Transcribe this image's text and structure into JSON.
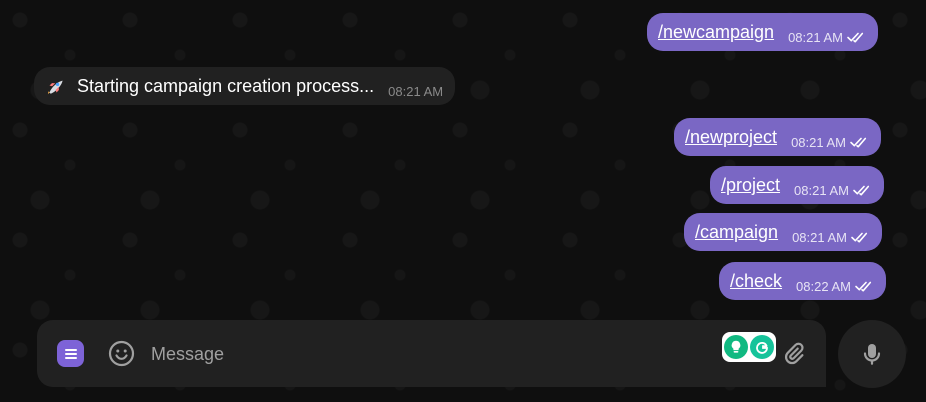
{
  "messages": [
    {
      "text": "/newcampaign",
      "time": "08:21 AM",
      "direction": "outgoing"
    },
    {
      "text": "Starting campaign creation process...",
      "time": "08:21 AM",
      "direction": "incoming",
      "icon": "rocket-emoji"
    },
    {
      "text": "/newproject",
      "time": "08:21 AM",
      "direction": "outgoing"
    },
    {
      "text": "/project",
      "time": "08:21 AM",
      "direction": "outgoing"
    },
    {
      "text": "/campaign",
      "time": "08:21 AM",
      "direction": "outgoing"
    },
    {
      "text": "/check",
      "time": "08:22 AM",
      "direction": "outgoing"
    }
  ],
  "composer": {
    "placeholder": "Message",
    "menu_icon": "menu-icon",
    "emoji_icon": "smile-icon",
    "attach_icon": "paperclip-icon",
    "mic_icon": "microphone-icon",
    "extension_icons": [
      "lightbulb-icon",
      "grammarly-icon"
    ]
  },
  "colors": {
    "outgoing_bubble": "#7a67c4",
    "incoming_bubble": "#212121",
    "accent": "#7d63d7",
    "background": "#0f0f0f"
  }
}
